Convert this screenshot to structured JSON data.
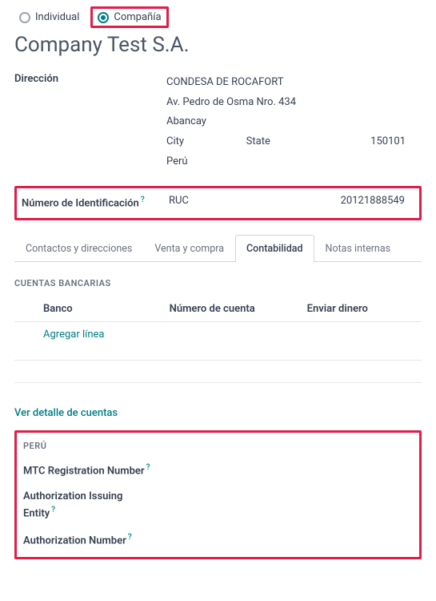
{
  "partnerType": {
    "individual": "Individual",
    "company": "Compañía"
  },
  "companyName": "Company Test S.A.",
  "addressLabel": "Dirección",
  "address": {
    "name": "CONDESA DE ROCAFORT",
    "street": "Av. Pedro de Osma Nro. 434",
    "city2": "Abancay",
    "city": "City",
    "state": "State",
    "zip": "150101",
    "country": "Perú"
  },
  "identification": {
    "label": "Número de Identificación",
    "type": "RUC",
    "number": "20121888549"
  },
  "tabs": {
    "contacts": "Contactos y direcciones",
    "sales": "Venta y compra",
    "accounting": "Contabilidad",
    "notes": "Notas internas"
  },
  "bank": {
    "heading": "CUENTAS BANCARIAS",
    "cols": {
      "bank": "Banco",
      "account": "Número de cuenta",
      "send": "Enviar dinero"
    },
    "addLine": "Agregar línea"
  },
  "viewAccounts": "Ver detalle de cuentas",
  "peru": {
    "heading": "PERÚ",
    "mtc": "MTC Registration Number",
    "issuing": "Authorization Issuing Entity",
    "authnum": "Authorization Number"
  },
  "helpGlyph": "?"
}
